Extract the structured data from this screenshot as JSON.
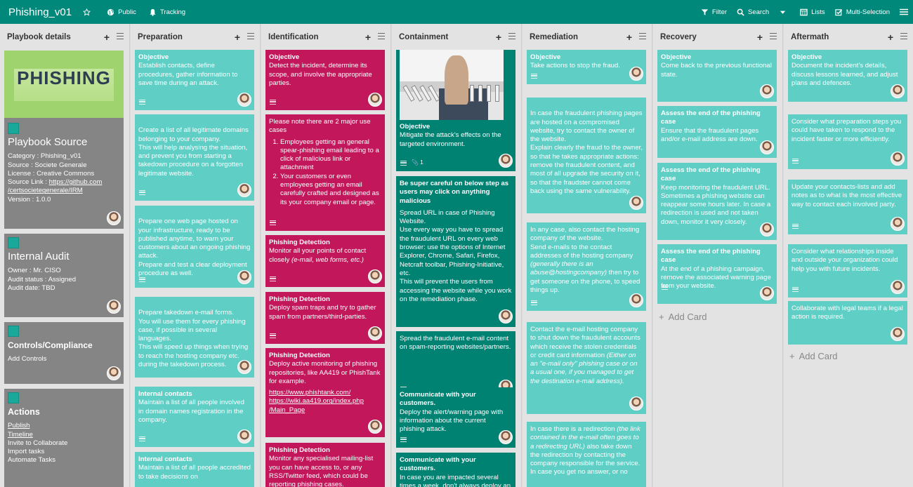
{
  "topbar": {
    "title": "Phishing_v01",
    "public": "Public",
    "tracking": "Tracking",
    "filter": "Filter",
    "search": "Search",
    "lists": "Lists",
    "multi": "Multi-Selection"
  },
  "icons": [
    "star-icon",
    "globe-icon",
    "bell-icon",
    "filter-icon",
    "search-icon",
    "caret-down-icon",
    "lists-icon",
    "checkbox-icon",
    "hamburger-icon",
    "plus-icon",
    "menu-icon",
    "description-icon",
    "attachment-icon",
    "avatar"
  ],
  "colors": {
    "topbar": "#00897b",
    "teal": "#5fcfc5",
    "dark_teal": "#008273",
    "red": "#c2185b",
    "grey": "#858585"
  },
  "lists": {
    "playbook": {
      "title": "Playbook details"
    },
    "preparation": {
      "title": "Preparation"
    },
    "identification": {
      "title": "Identification"
    },
    "containment": {
      "title": "Containment"
    },
    "remediation": {
      "title": "Remediation"
    },
    "recovery": {
      "title": "Recovery",
      "add_card": "Add Card"
    },
    "aftermath": {
      "title": "Aftermath",
      "add_card": "Add Card"
    }
  },
  "playbook": {
    "image_text": "PHISHING",
    "source_title": "Playbook Source",
    "category": "Category : Phishing_v01",
    "source": "Source : Societe Generale",
    "license": "License : Creative Commons",
    "link_prefix": "Source Link : ",
    "link1": "https://github.com",
    "link2": "/certsocietegenerale/IRM",
    "version": "Version : 1.0.0",
    "audit_title": "Internal Audit",
    "owner": "Owner : Mr. CISO",
    "audit_status": "Audit status : Assigned",
    "audit_date": "Audit date: TBD",
    "controls_title": "Controls/Compliance",
    "add_controls": "Add Controls",
    "actions_title": "Actions",
    "publish": "Publish",
    "timeline": "Timeline",
    "invite": "Invite to Collaborate",
    "import": "Import tasks",
    "automate": "Automate Tasks"
  },
  "preparation": {
    "c1_title": "Objective",
    "c1_text": "Establish contacts, define procedures, gather information to save time during an attack.",
    "c2_text": "Create a list of all legitimate domains belonging to your company.\nThis will help analysing the situation, and prevent you from starting a takedown procedure on a forgotten legitimate website.",
    "c3_text": "Prepare one web page hosted on your infrastructure, ready to be published anytime, to warn your customers about an ongoing phishing attack.\nPrepare and test a clear deployment procedure as well.",
    "c4_text": "Prepare takedown e-mail forms.\nYou will use them for every phishing case, if possible in several languages.\nThis will speed up things when trying to reach the hosting company etc. during the takedown process.",
    "c5_title": "Internal contacts",
    "c5_text": "Maintain a list of all people involved in domain names registration in the company.",
    "c6_title": "Internal contacts",
    "c6_text": "Maintain a list of all people accredited to take decisions on"
  },
  "identification": {
    "c1_title": "Objective",
    "c1_text": "Detect the incident, determine its scope, and involve the appropriate parties.",
    "c2_text": "Please note there are 2 major use cases",
    "c2_li1": "Employees getting an general spear-phishing email leading to a click of malicious link or attachment",
    "c2_li2": "Your customers or even employees getting an email carefully crafted and designed as its your company email or page.",
    "c3_title": "Phishing Detection",
    "c3_text": "Monitor all your points of contact closely",
    "c3_italic": "(e-mail, web forms, etc.)",
    "c4_title": "Phishing Detection",
    "c4_text": "Deploy spam traps and try to gather spam from partners/third-parties.",
    "c5_title": "Phishing Detection",
    "c5_text": "Deploy active monitoring of phishing repositories, like AA419 or PhishTank for example.",
    "c5_link1": "https://www.phishtank.com/",
    "c5_link2": "https://wiki.aa419.org/index.php",
    "c5_link3": "/Main_Page",
    "c6_title": "Phishing Detection",
    "c6_text": "Monitor any specialised mailing-list you can have access to, or any RSS/Twitter feed, which could be reporting phishing cases."
  },
  "containment": {
    "c1_title": "Objective",
    "c1_text": "Mitigate the attack's effects on the targeted environment.",
    "c1_attach": "1",
    "c2_title": "Be super careful on below step as users may click on anything malicious",
    "c2_text": "Spread URL in case of Phishing Website.\nUse every way you have to spread the fraudulent URL on every web browser: use the options of Internet Explorer, Chrome, Safari, Firefox, Netcraft toolbar, Phishing-Initiative, etc.\nThis will prevent the users from accessing the website while you work on the remediation phase.",
    "c3_text": "Spread the fraudulent e-mail content on spam-reporting websites/partners.",
    "c4_title": "Communicate with your customers.",
    "c4_text": "Deploy the alert/warning page with information about the current phishing attack.",
    "c5_title": "Communicate with your customers.",
    "c5_text": "In case you are impacted several times a week, don't always deploy an alert/warning page but rather a"
  },
  "remediation": {
    "c1_title": "Objective",
    "c1_text": "Take actions to stop the fraud.",
    "c2_text": "In case the fraudulent phishing pages are hosted on a compromised website, try to contact the owner of the website.\nExplain clearly the fraud to the owner, so that he takes appropriate actions: remove the fraudulent content, and most of all upgrade the security on it, so that the fraudster cannot come back using the same vulnerability.",
    "c3_text": "In any case, also contact the hosting company of the website.\nSend e-mails to the contact addresses of the hosting company",
    "c3_italic": "(generally there is an abuse@hostingcompany)",
    "c3_tail": "then try to get someone on the phone, to speed things up.",
    "c4_text": "Contact the e-mail hosting company to shut down the fraudulent accounts which receive the stolen credentials or credit card information",
    "c4_italic": "(Either on an \"e-mail only\" phishing case or on a usual one, if you managed to get the destination e-mail address).",
    "c5_text": "In case there is a redirection",
    "c5_italic": "(the link contained in the e-mail often goes to a redirecting URL)",
    "c5_tail": "also take down the redirection by contacting the company responsible for the service.\nIn case you get no answer, or no"
  },
  "recovery": {
    "c1_title": "Objective",
    "c1_text": "Come back to the previous functional state.",
    "c2_title": "Assess the end of the phishing case",
    "c2_text": "Ensure that the fraudulent pages and/or e-mail address are down.",
    "c3_title": "Assess the end of the phishing case",
    "c3_text": "Keep monitoring the fraudulent URL. Sometimes a phishing website can reappear some hours later. In case a redirection is used and not taken down, monitor it very closely.",
    "c4_title": "Assess the end of the phishing case",
    "c4_text": "At the end of a phishing campaign, remove the associated warning page from your website."
  },
  "aftermath": {
    "c1_title": "Objective",
    "c1_text": "Document the incident's details, discuss lessons learned, and adjust plans and defences.",
    "c2_text": "Consider what preparation steps you could have taken to respond to the incident faster or more efficiently.",
    "c3_text": "Update your contacts-lists and add notes as to what is the most effective way to contact each involved party.",
    "c4_text": "Consider what relationships inside and outside your organization could help you with future incidents.",
    "c5_text": "Collaborate with legal teams if a legal action is required."
  }
}
